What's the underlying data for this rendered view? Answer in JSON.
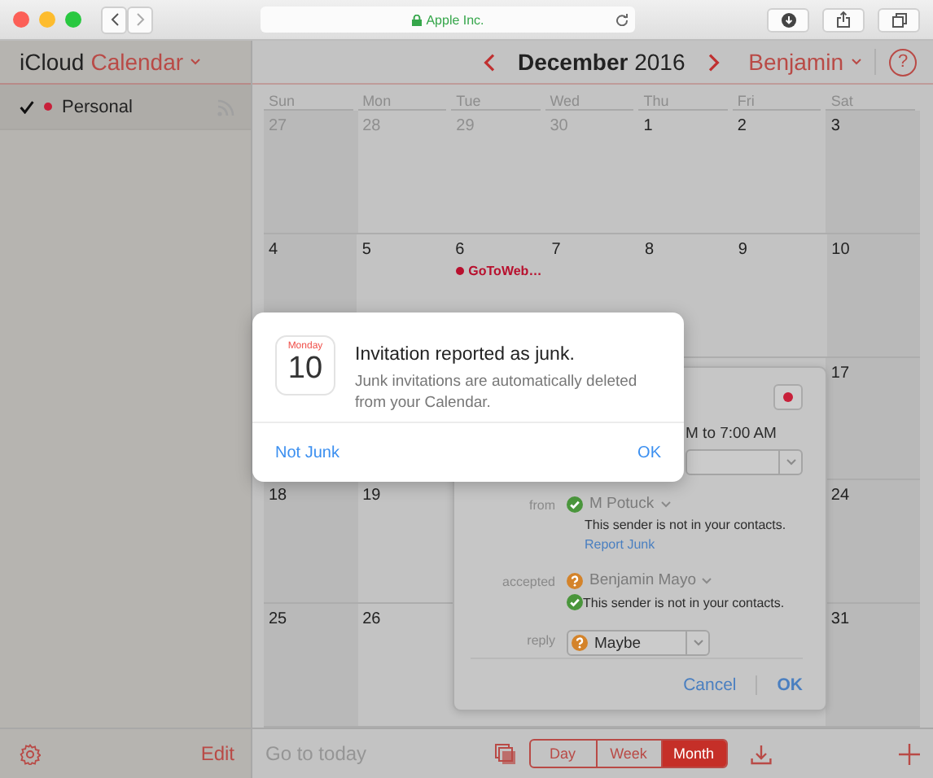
{
  "browser": {
    "address": "Apple Inc."
  },
  "app": {
    "brand": "iCloud",
    "name": "Calendar"
  },
  "sidebar": {
    "calendars": [
      {
        "name": "Personal",
        "checked": true,
        "color": "#c8203a"
      }
    ],
    "edit": "Edit"
  },
  "header": {
    "month": "December",
    "year": "2016",
    "user": "Benjamin",
    "help": "?"
  },
  "calendar": {
    "weekdays": [
      "Sun",
      "Mon",
      "Tue",
      "Wed",
      "Thu",
      "Fri",
      "Sat"
    ],
    "weeks": [
      {
        "days": [
          {
            "day": "27",
            "muted": true
          },
          {
            "day": "28",
            "muted": true
          },
          {
            "day": "29",
            "muted": true
          },
          {
            "day": "30",
            "muted": true
          },
          {
            "day": "1",
            "muted": false
          },
          {
            "day": "2",
            "muted": false
          },
          {
            "day": "3",
            "muted": false
          }
        ]
      },
      {
        "days": [
          {
            "day": "4",
            "muted": false
          },
          {
            "day": "5",
            "muted": false
          },
          {
            "day": "6",
            "muted": false,
            "events": [
              {
                "title": "GoToWeb…",
                "color": "#b8102e"
              }
            ]
          },
          {
            "day": "7",
            "muted": false
          },
          {
            "day": "8",
            "muted": false
          },
          {
            "day": "9",
            "muted": false
          },
          {
            "day": "10",
            "muted": false
          }
        ]
      },
      {
        "end_days": [
          {
            "day": "17",
            "muted": false
          }
        ]
      },
      {
        "days": [
          {
            "day": "18",
            "muted": false
          },
          {
            "day": "19",
            "muted": false
          }
        ],
        "end_days": [
          {
            "day": "24",
            "muted": false
          }
        ]
      },
      {
        "days": [
          {
            "day": "25",
            "muted": false
          },
          {
            "day": "26",
            "muted": false
          }
        ],
        "end_days": [
          {
            "day": "31",
            "muted": false
          }
        ]
      }
    ]
  },
  "toolbar": {
    "today": "Go to today",
    "views": [
      {
        "label": "Day",
        "selected": false
      },
      {
        "label": "Week",
        "selected": false
      },
      {
        "label": "Month",
        "selected": true
      }
    ]
  },
  "popover": {
    "time_fragment": "M to 7:00 AM",
    "attendees": [
      {
        "label": "from",
        "status": {
          "kind": "accepted"
        },
        "name": "M Potuck",
        "note": "This sender is not in your contacts.",
        "link": "Report Junk"
      },
      {
        "label": "accepted",
        "status": {
          "kind": "maybe"
        },
        "name": "Benjamin Mayo",
        "note_status": {
          "kind": "accepted"
        },
        "note": "This sender is not in your contacts."
      }
    ],
    "reply": {
      "label": "reply",
      "status": {
        "kind": "maybe"
      },
      "value": "Maybe"
    },
    "buttons": [
      "Cancel",
      "OK"
    ]
  },
  "alert": {
    "icon_weekday": "Monday",
    "icon_day": "10",
    "title": "Invitation reported as junk.",
    "message": "Junk invitations are automatically deleted from your Calendar.",
    "buttons": [
      "Not Junk",
      "OK"
    ]
  }
}
